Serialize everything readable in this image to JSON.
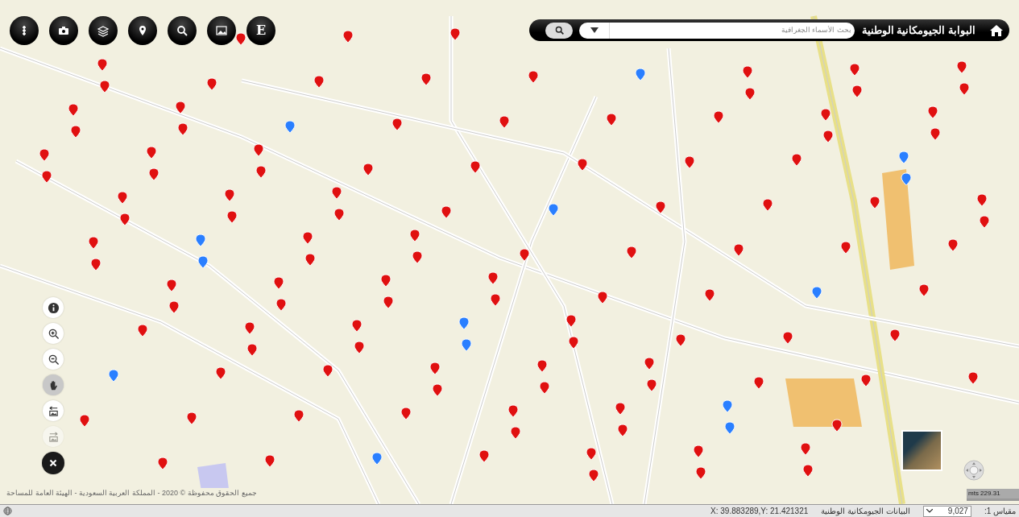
{
  "toolbar": [
    {
      "kind": "more"
    },
    {
      "kind": "camera"
    },
    {
      "kind": "layers"
    },
    {
      "kind": "pin"
    },
    {
      "kind": "search"
    },
    {
      "kind": "image"
    },
    {
      "kind": "letter",
      "label": "E"
    }
  ],
  "header": {
    "title": "البوابة الجيومكانية الوطنية",
    "search": {
      "placeholder": "بحث الأسماء الجغرافية"
    }
  },
  "map_tools": [
    {
      "kind": "info",
      "active": false,
      "disabled": false
    },
    {
      "kind": "zoom_in",
      "active": false,
      "disabled": false
    },
    {
      "kind": "zoom_out",
      "active": false,
      "disabled": false
    },
    {
      "kind": "pan",
      "active": true,
      "disabled": false
    },
    {
      "kind": "back",
      "active": false,
      "disabled": false
    },
    {
      "kind": "forward",
      "active": false,
      "disabled": true
    },
    {
      "kind": "close",
      "active": false,
      "disabled": false
    }
  ],
  "attribution": "جميع الحقوق محفوظة © 2020 - المملكة العربية السعودية - الهيئة العامة للمساحة",
  "scale_bar": "mts 229.31",
  "status_bar": {
    "coordinates": "X: 39.883289,Y: 21.421321",
    "source": "البيانات الجيومكانية الوطنية",
    "scale_value": "9,027",
    "scale_label": "مقياس 1:"
  }
}
